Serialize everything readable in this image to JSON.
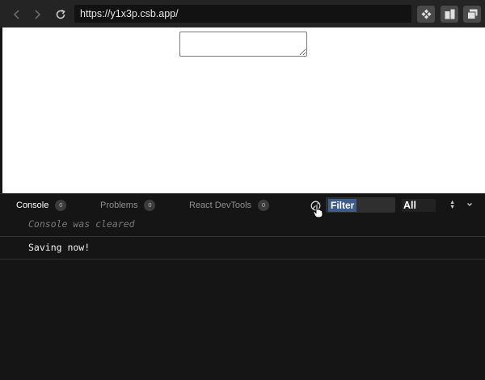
{
  "browser": {
    "url": "https://y1x3p.csb.app/",
    "back_icon": "chevron-left-icon",
    "forward_icon": "chevron-right-icon",
    "refresh_icon": "refresh-icon",
    "toolbar_icons": [
      "codesandbox-icon",
      "split-view-icon",
      "new-window-icon"
    ]
  },
  "preview": {
    "textarea_value": ""
  },
  "devtools": {
    "tabs": [
      {
        "label": "Console",
        "count": "0",
        "active": true
      },
      {
        "label": "Problems",
        "count": "0",
        "active": false
      },
      {
        "label": "React DevTools",
        "count": "0",
        "active": false
      }
    ],
    "filter_placeholder": "Filter",
    "level_selected": "All",
    "clear_icon": "clear-console-icon",
    "collapse_icon": "chevron-down-icon",
    "logs": [
      {
        "text": "Console was cleared",
        "kind": "info"
      },
      {
        "text": "Saving now!",
        "kind": "log"
      }
    ]
  },
  "colors": {
    "chrome_bg": "#242424",
    "devtools_bg": "#151515",
    "filter_highlight": "#3d5c8a"
  }
}
